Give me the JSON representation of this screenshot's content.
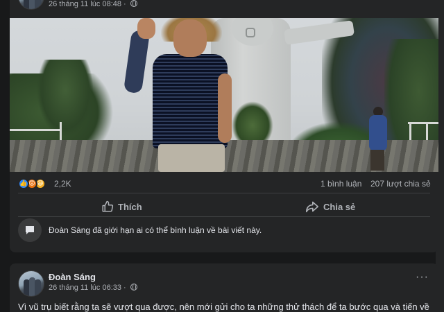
{
  "post1": {
    "timestamp": "26 tháng 11 lúc 08:48 ·",
    "reactions": {
      "icons": [
        "like-icon",
        "angry-icon",
        "haha-icon"
      ],
      "count": "2,2K"
    },
    "comments": "1 bình luận",
    "shares": "207 lượt chia sẻ",
    "actions": {
      "like_label": "Thích",
      "share_label": "Chia sẻ"
    },
    "restriction_notice": "Đoàn Sáng đã giới hạn ai có thể bình luận về bài viết này."
  },
  "post2": {
    "author": "Đoàn Sáng",
    "timestamp": "26 tháng 11 lúc 06:33 ·",
    "more_label": "···",
    "text": "Vì vũ trụ biết rằng ta sẽ vượt qua được, nên mới gửi cho ta những thử thách để ta bước qua và tiến về"
  },
  "colors": {
    "background": "#18191a",
    "card": "#242526",
    "text_primary": "#e4e6eb",
    "text_secondary": "#b0b3b8",
    "like_blue": "#2d88ff"
  }
}
